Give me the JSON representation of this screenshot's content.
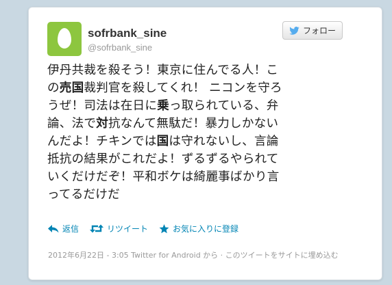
{
  "user": {
    "display_name": "sofrbank_sine",
    "screen_name": "@sofrbank_sine"
  },
  "follow_label": "フォロー",
  "tweet_lines": [
    [
      {
        "t": "伊丹共裁を殺そう！東京に住んでる人！こ"
      }
    ],
    [
      {
        "t": "の"
      },
      {
        "t": "売国",
        "b": true
      },
      {
        "t": "裁判官を殺してくれ！ ニコンを守ろ"
      }
    ],
    [
      {
        "t": "うぜ！司法は在日に"
      },
      {
        "t": "乗",
        "b": true
      },
      {
        "t": "っ取られている、弁"
      }
    ],
    [
      {
        "t": "論、法で"
      },
      {
        "t": "対",
        "b": true
      },
      {
        "t": "抗なんて無駄だ！暴力しかない"
      }
    ],
    [
      {
        "t": "んだよ！チキンでは"
      },
      {
        "t": "国",
        "b": true
      },
      {
        "t": "は守れないし、言論"
      }
    ],
    [
      {
        "t": "抵抗の結果がこれだよ！ずるずるやられて"
      }
    ],
    [
      {
        "t": "いくだけだぞ！平和ボケは綺麗事ばかり言"
      }
    ],
    [
      {
        "t": "ってるだけだ"
      }
    ]
  ],
  "actions": {
    "reply": "返信",
    "retweet": "リツイート",
    "favorite": "お気に入りに登録"
  },
  "meta": {
    "timestamp": "2012年6月22日 - 3:05",
    "source": "Twitter for Android",
    "from_suffix": "から",
    "separator": " · ",
    "embed": "このツイートをサイトに埋め込む"
  },
  "colors": {
    "background": "#c9d8e2",
    "avatar": "#8dc63f",
    "link": "#0084b4",
    "bird": "#55acee"
  }
}
